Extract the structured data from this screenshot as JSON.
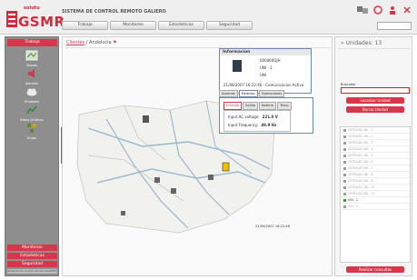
{
  "header": {
    "logo_small": "solutu",
    "logo_big": "GSMR",
    "system_title": "SISTEMA DE CONTROL REMOTO GALIERO",
    "nav": [
      "Trabajo",
      "Monitoreo",
      "Estadisticas",
      "Seguridad"
    ]
  },
  "sidebar": {
    "header": "Trabajo",
    "items": [
      {
        "label": "Mapas",
        "icon": "map-icon"
      },
      {
        "label": "Alarmas",
        "icon": "speaker-icon"
      },
      {
        "label": "Unidades",
        "icon": "cloud-icon"
      },
      {
        "label": "Datos Graficos",
        "icon": "chart-icon"
      },
      {
        "label": "Grupo",
        "icon": "group-icon"
      }
    ],
    "bottom_tabs": [
      "Monitoreo",
      "Estadisticas",
      "Seguridad"
    ],
    "footer": "Sistema de control remoto GALIERO"
  },
  "center": {
    "breadcrumb_link": "Clientes",
    "breadcrumb_rest": "/ Andalucia"
  },
  "info_popup": {
    "title": "Informacion",
    "line1": "000460GJH",
    "line2": "UNI - 2",
    "line3": "UNI",
    "footer": "21/09/2007 16:22:46 - Comunicacion Activa"
  },
  "tabs_outer": [
    "Alarmas",
    "Medidas",
    "Operaciones"
  ],
  "tabs_inner": [
    "Entrada",
    "Salida",
    "Bateria",
    "Temp"
  ],
  "measures": [
    {
      "label": "Input AC voltage:",
      "value": "221.0 V"
    },
    {
      "label": "Input Frequency:",
      "value": "49.9 Hz"
    }
  ],
  "map_timestamp": "21/09/2007 16:22:46",
  "right": {
    "title": "Unidades: 13",
    "search_label": "Buscador",
    "btn1": "Localizar Unidad",
    "btn2": "Borrar Unidad",
    "rows": [
      "GETRAUD UNI - 1",
      "GETRAUD UNI - 2",
      "GETRAUD UNI - 3",
      "GETRAUD UNI - 4",
      "GETRAUD UNI - 5",
      "GETRAUD UNI - 6",
      "GETRAUD UNI - 7",
      "GETRAUD UNI - 8",
      "GETRAUD UNI - 9",
      "GETRAUD UNI - 10",
      "GETRAUD UNI - 11",
      "UNI - 2",
      "UNI - 3"
    ],
    "bottom_btn": "Realizar consultas"
  },
  "colors": {
    "accent": "#d8364a",
    "sidebar_bg": "#8e8e8e"
  }
}
